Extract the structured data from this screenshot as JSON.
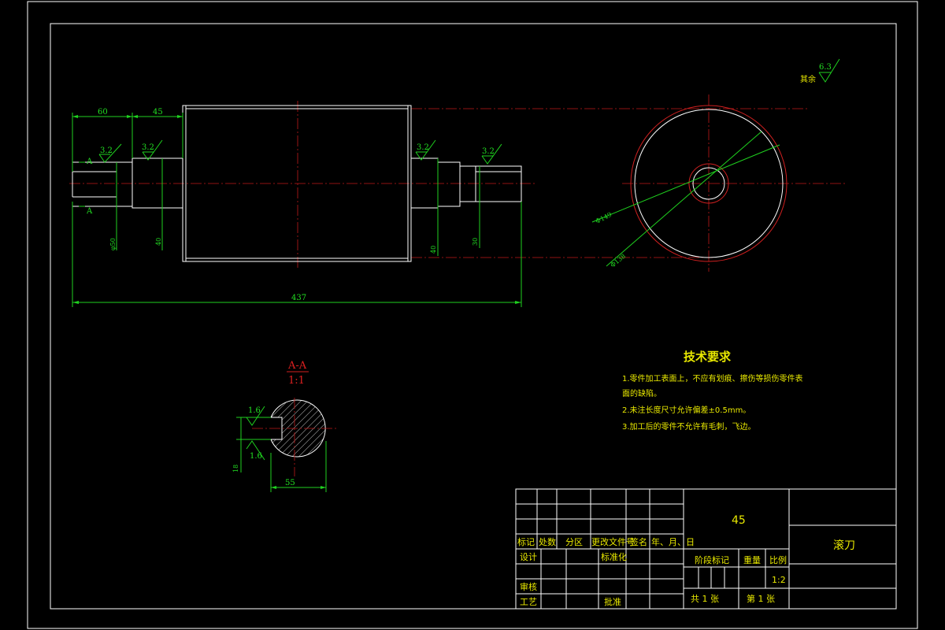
{
  "drawing": {
    "roughness_other_label": "其余",
    "roughness_other_value": "6.3",
    "section_mark": "A",
    "dims": {
      "d60": "60",
      "d45": "45",
      "d437": "437",
      "r32a": "3.2",
      "r32b": "3.2",
      "r32c": "3.2",
      "r32d": "3.2",
      "phi50": "φ50",
      "phi40a": "40",
      "phi40b": "40",
      "phi30": "30",
      "phi149": "Φ149",
      "phi138": "Φ138"
    },
    "section": {
      "title": "A-A",
      "scale": "1:1",
      "r16a": "1.6",
      "r16b": "1.6",
      "d18": "18",
      "d55": "55"
    },
    "tech": {
      "heading": "技术要求",
      "line1": "1.零件加工表面上，不应有划痕、擦伤等损伤零件表",
      "line1b": "面的缺陷。",
      "line2": "2.未注长度尺寸允许偏差±0.5mm。",
      "line3": "3.加工后的零件不允许有毛刺，飞边。"
    }
  },
  "title_block": {
    "material": "45",
    "part_name": "滚刀",
    "col_labels": [
      "标记",
      "处数",
      "分区",
      "更改文件号",
      "签名",
      "年、月、日"
    ],
    "design": "设计",
    "standardize": "标准化",
    "stage_mark": "阶段标记",
    "weight": "重量",
    "scale_label": "比例",
    "scale_value": "1:2",
    "review": "审核",
    "process": "工艺",
    "approve": "批准",
    "sheets_total": "共  1  张",
    "sheet_no": "第  1  张"
  }
}
